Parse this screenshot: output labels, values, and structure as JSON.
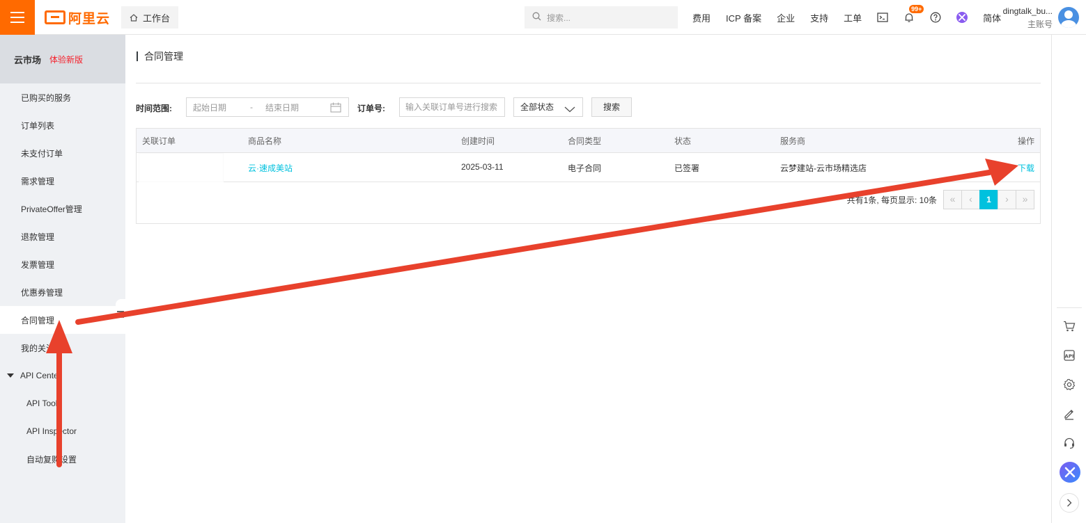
{
  "topbar": {
    "logo_text": "阿里云",
    "workbench_label": "工作台",
    "search_placeholder": "搜索...",
    "nav": {
      "fees": "费用",
      "icp": "ICP 备案",
      "enterprise": "企业",
      "support": "支持",
      "ticket": "工单"
    },
    "notification_badge": "99+",
    "language": "简体",
    "account_name": "dingtalk_bu...",
    "account_role": "主账号",
    "brand_color": "#ff6a00"
  },
  "sidebar": {
    "title": "云市场",
    "beta_label": "体验新版",
    "items": [
      {
        "label": "已购买的服务"
      },
      {
        "label": "订单列表"
      },
      {
        "label": "未支付订单"
      },
      {
        "label": "需求管理"
      },
      {
        "label": "PrivateOffer管理"
      },
      {
        "label": "退款管理"
      },
      {
        "label": "发票管理"
      },
      {
        "label": "优惠券管理"
      },
      {
        "label": "合同管理",
        "active": true
      },
      {
        "label": "我的关注"
      }
    ],
    "group": {
      "label": "API Center",
      "children": [
        {
          "label": "API Tool"
        },
        {
          "label": "API Inspector"
        },
        {
          "label": "自动复购设置"
        }
      ]
    }
  },
  "main": {
    "page_title": "合同管理",
    "filters": {
      "time_range_label": "时间范围:",
      "start_placeholder": "起始日期",
      "separator": "-",
      "end_placeholder": "结束日期",
      "order_label": "订单号:",
      "order_placeholder": "输入关联订单号进行搜索",
      "status_value": "全部状态",
      "search_button": "搜索"
    },
    "table": {
      "columns": [
        "关联订单",
        "商品名称",
        "创建时间",
        "合同类型",
        "状态",
        "服务商",
        "操作"
      ],
      "rows": [
        {
          "order": "",
          "product": "云·速成美站",
          "created": "2025-03-11",
          "type": "电子合同",
          "status": "已签署",
          "vendor": "云梦建站-云市场精选店",
          "action": "下载"
        }
      ]
    },
    "pagination": {
      "info": "共有1条, 每页显示: 10条",
      "current_page": "1",
      "first": "«",
      "prev": "‹",
      "next": "›",
      "last": "»"
    },
    "accent_color": "#00c1de"
  },
  "annotation": {
    "arrow_color": "#e8412c"
  }
}
